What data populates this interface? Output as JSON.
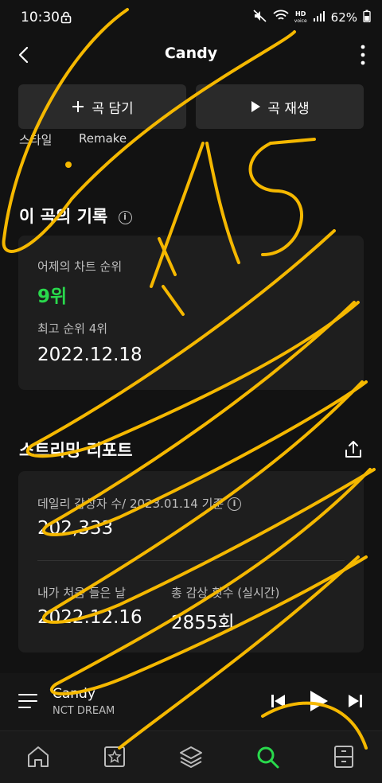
{
  "status_bar": {
    "time": "10:30",
    "battery": "62%",
    "hd_top": "HD",
    "hd_bottom": "voice"
  },
  "header": {
    "title": "Candy"
  },
  "actions": {
    "add_label": "곡 담기",
    "play_label": "곡 재생"
  },
  "peek_row": {
    "left": "스타일",
    "right": "Remake"
  },
  "record": {
    "title": "이 곡의 기록",
    "yesterday_label": "어제의 차트 순위",
    "yesterday_rank": "9위",
    "best_label": "최고 순위 4위",
    "best_date": "2022.12.18"
  },
  "report": {
    "title": "스트리밍 리포트",
    "daily_label": "데일리 감상자 수/ 2023.01.14 기준",
    "daily_value": "202,333",
    "first_label": "내가 처음 들은 날",
    "first_value": "2022.12.16",
    "total_label": "총 감상 횟수 (실시간)",
    "total_value": "2855회"
  },
  "player": {
    "song": "Candy",
    "artist": "NCT DREAM"
  },
  "nav": {
    "items": [
      "home",
      "my-music",
      "library",
      "search",
      "storage"
    ],
    "active": "search"
  },
  "colors": {
    "accent": "#29d94c",
    "background": "#121212",
    "card": "#1e1e1e",
    "scribble": "#f5b800"
  },
  "annotation": {
    "handwritten_text": "1/15"
  }
}
